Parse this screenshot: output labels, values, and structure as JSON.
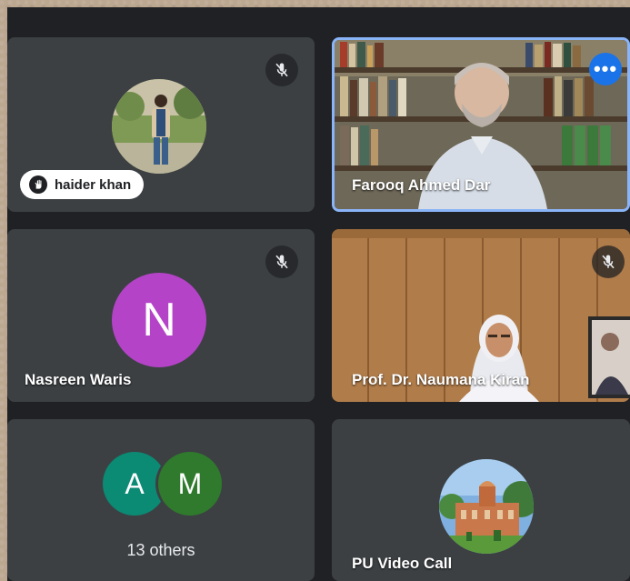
{
  "participants": [
    {
      "name": "haider khan",
      "muted": true,
      "speaking_icon": "hand-icon"
    },
    {
      "name": "Farooq Ahmed Dar",
      "menu_label": "•••"
    },
    {
      "name": "Nasreen Waris",
      "initial": "N",
      "avatar_color": "#b543c8",
      "muted": true
    },
    {
      "name": "Prof. Dr. Naumana Kiran",
      "muted": true
    },
    {
      "group_initials": [
        "A",
        "M"
      ],
      "group_colors": [
        "#0b8a74",
        "#2f7a2c"
      ],
      "others_label": "13 others"
    },
    {
      "name": "PU Video Call"
    }
  ],
  "colors": {
    "tile": "#3c4043",
    "active_border": "#8ab4f8",
    "more_button": "#1a73e8"
  }
}
